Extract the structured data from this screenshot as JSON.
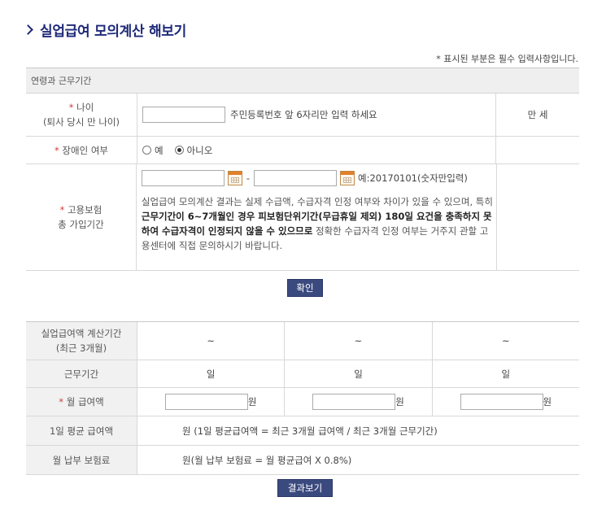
{
  "page": {
    "title": "실업급여 모의계산 해보기",
    "required_note": "* 표시된 부분은 필수 입력사항입니다."
  },
  "section1": {
    "header": "연령과 근무기간",
    "age": {
      "star": "*",
      "label": "나이",
      "sublabel": "(퇴사 당시 만 나이)",
      "input_value": "",
      "hint": "주민등록번호 앞 6자리만 입력 하세요",
      "result": "만 세"
    },
    "disability": {
      "star": "*",
      "label": "장애인 여부",
      "yes": "예",
      "no": "아니오",
      "selected": "아니오"
    },
    "insurance": {
      "star": "*",
      "label": "고용보험",
      "sublabel": "총 가입기간",
      "start": "",
      "end": "",
      "dash": "-",
      "date_hint": "예:20170101(숫자만입력)",
      "note_pre": "실업급여 모의계산 결과는 실제 수급액, 수급자격 인정 여부와 차이가 있을 수 있으며, 특히 ",
      "note_bold": "근무기간이 6~7개월인 경우 피보험단위기간(무급휴일 제외) 180일 요건을 충족하지 못하여 수급자격이 인정되지 않을 수 있으므로",
      "note_post": " 정확한 수급자격 인정 여부는 거주지 관할 고용센터에 직접 문의하시기 바랍니다."
    },
    "confirm_button": "확인"
  },
  "section2": {
    "period": {
      "label": "실업급여액 계산기간",
      "sublabel": "(최근 3개월)",
      "cells": [
        "~",
        "~",
        "~"
      ]
    },
    "work_days": {
      "label": "근무기간",
      "cells": [
        "일",
        "일",
        "일"
      ]
    },
    "monthly_pay": {
      "star": "*",
      "label": "월 급여액",
      "values": [
        "",
        "",
        ""
      ],
      "unit": "원"
    },
    "daily_avg": {
      "label": "1일 평균 급여액",
      "text": "원 (1일 평균급여액 = 최근 3개월 급여액 / 최근 3개월 근무기간)"
    },
    "premium": {
      "label": "월 납부 보험료",
      "text": "원(월 납부 보험료 = 월 평균급여 X 0.8%)"
    },
    "result_button": "결과보기"
  }
}
